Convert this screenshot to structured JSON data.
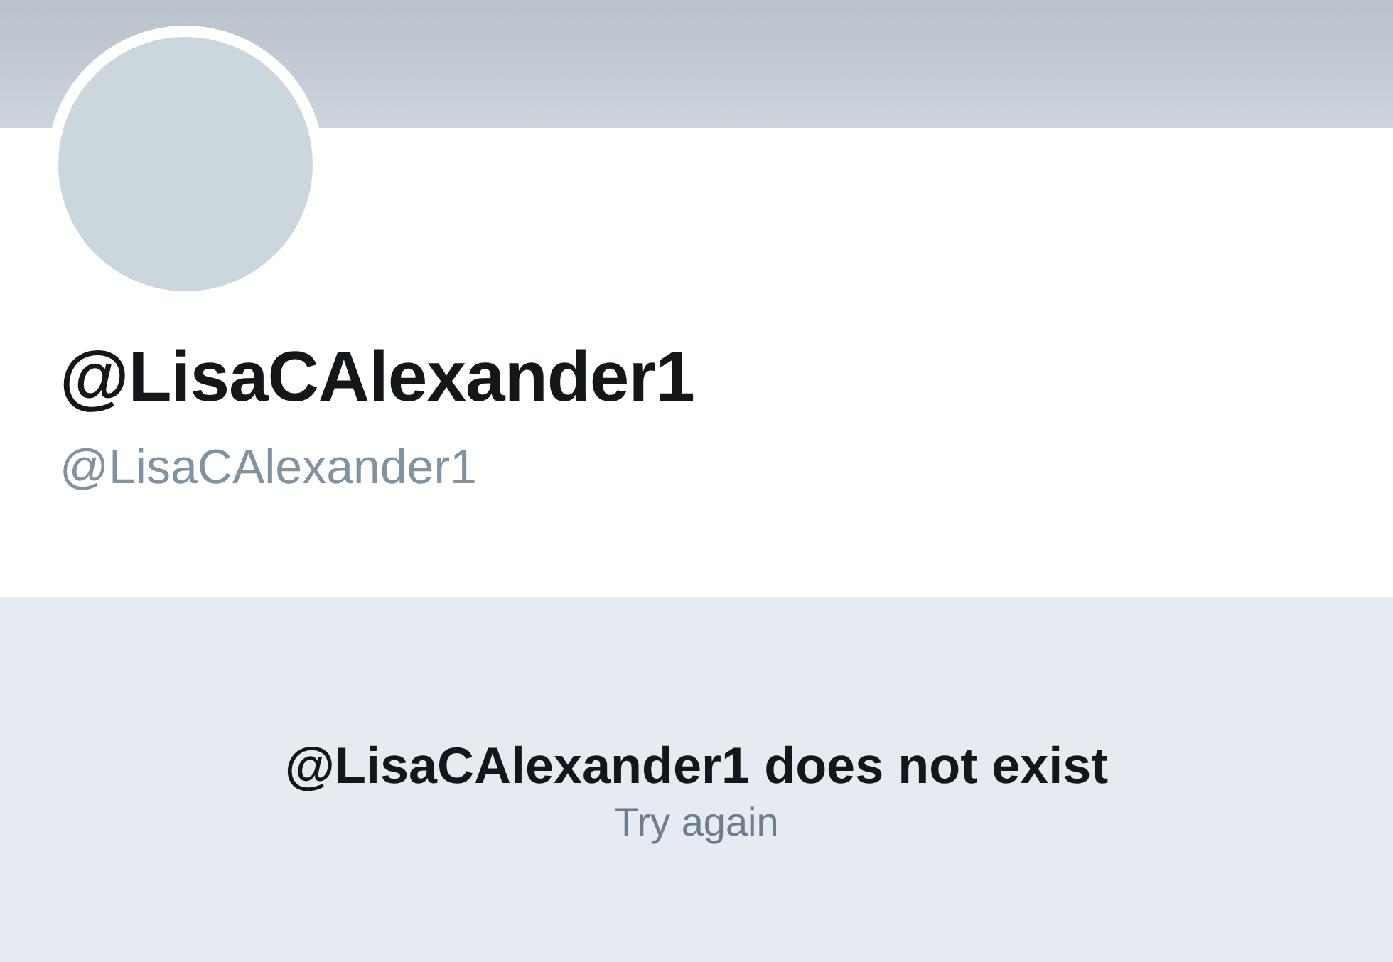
{
  "profile": {
    "display_name": "@LisaCAlexander1",
    "handle": "@LisaCAlexander1"
  },
  "notice": {
    "message": "@LisaCAlexander1 does not exist",
    "action": "Try again"
  }
}
